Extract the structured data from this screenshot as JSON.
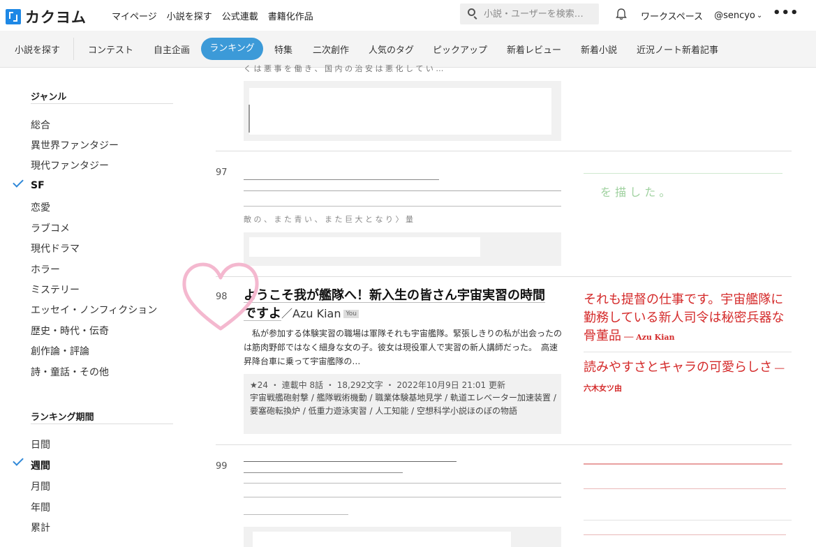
{
  "header": {
    "logo_text": "カクヨム",
    "links": [
      "マイページ",
      "小説を探す",
      "公式連載",
      "書籍化作品"
    ],
    "search_placeholder": "小説・ユーザーを検索…",
    "workspace": "ワークスペース",
    "username": "@sencyo",
    "more": "•••"
  },
  "nav": {
    "items": [
      "小説を探す",
      "コンテスト",
      "自主企画",
      "ランキング",
      "特集",
      "二次創作",
      "人気のタグ",
      "ピックアップ",
      "新着レビュー",
      "新着小説",
      "近況ノート新着記事"
    ],
    "active": "ランキング"
  },
  "sidebar": {
    "genre_heading": "ジャンル",
    "genres": [
      "総合",
      "異世界ファンタジー",
      "現代ファンタジー",
      "SF",
      "恋愛",
      "ラブコメ",
      "現代ドラマ",
      "ホラー",
      "ミステリー",
      "エッセイ・ノンフィクション",
      "歴史・時代・伝奇",
      "創作論・評論",
      "詩・童話・その他"
    ],
    "active_genre": "SF",
    "period_heading": "ランキング期間",
    "periods": [
      "日間",
      "週間",
      "月間",
      "年間",
      "累計"
    ],
    "active_period": "週間"
  },
  "ranking": {
    "top_partial_text": "く は 悪 事 を 働 き 、 国 内 の 治 安 は 悪 化 し て い …",
    "rank97": "97",
    "rank97_partial_line": "敵 の 、 ま た 青 い 、 ま た 巨 大 と な り 〉 量",
    "rank97_review_green": "を 描 し た 。",
    "rank98": {
      "rank": "98",
      "title": "ようこそ我が艦隊へ！新入生の皆さん宇宙実習の時間ですよ",
      "author": "／Azu Kian",
      "badge": "You",
      "catch": "私が参加する体験実習の職場は軍隊それも宇宙艦隊。緊張しきりの私が出会ったのは筋肉野郎ではなく細身な女の子。彼女は現役軍人で実習の新人講師だった。　高速昇降台車に乗って宇宙艦隊の…",
      "stats": "★24 ・ 連載中 8話 ・ 18,292文字 ・ 2022年10月9日 21:01 更新",
      "tags": "宇宙戦艦砲射撃 / 艦隊戦術機動 / 職業体験基地見学 / 軌道エレベーター加速装置 / 要塞砲転換炉 / 低重力遊泳実習 / 人工知能 / 空想科学小説ほのぼの物語",
      "reviews": [
        {
          "text": "それも提督の仕事です。宇宙艦隊に勤務している新人司令は秘密兵器な骨董品",
          "by": "── Azu Kian"
        },
        {
          "text": "読みやすさとキャラの可愛らしさ",
          "by": "── 六木女ツ由"
        }
      ]
    },
    "rank99": "99"
  },
  "colors": {
    "accent": "#3c9ad8",
    "check": "#2f88d8",
    "review": "#d42a2a",
    "heart": "#f4b8cf",
    "logo": "#1e88e5"
  }
}
